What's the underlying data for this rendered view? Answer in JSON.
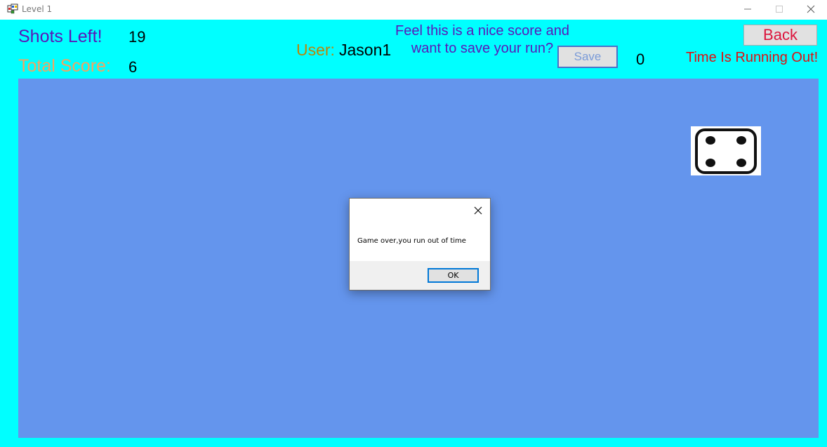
{
  "window": {
    "title": "Level 1",
    "icon": "winforms-app-icon"
  },
  "hud": {
    "shots_label": "Shots Left!",
    "shots_value": "19",
    "score_label": "Total Score:",
    "score_value": "6",
    "user_label": "User:",
    "user_value": "Jason1",
    "save_prompt": "Feel this is a nice score and want to save your run?",
    "save_label": "Save",
    "save_count": "0",
    "back_label": "Back",
    "time_warning": "Time Is Running Out!"
  },
  "game": {
    "die_face": 4,
    "die_icon": "die-four-icon"
  },
  "dialog": {
    "message": "Game over,you run out of time",
    "ok_label": "OK"
  },
  "colors": {
    "client_background": "#00ffff",
    "field_background": "#6495ed",
    "shots_label": "#5a18b8",
    "score_label": "#f4a460",
    "user_label": "#b8860b",
    "back_text": "#dc143c",
    "time_warning": "#e01010"
  }
}
